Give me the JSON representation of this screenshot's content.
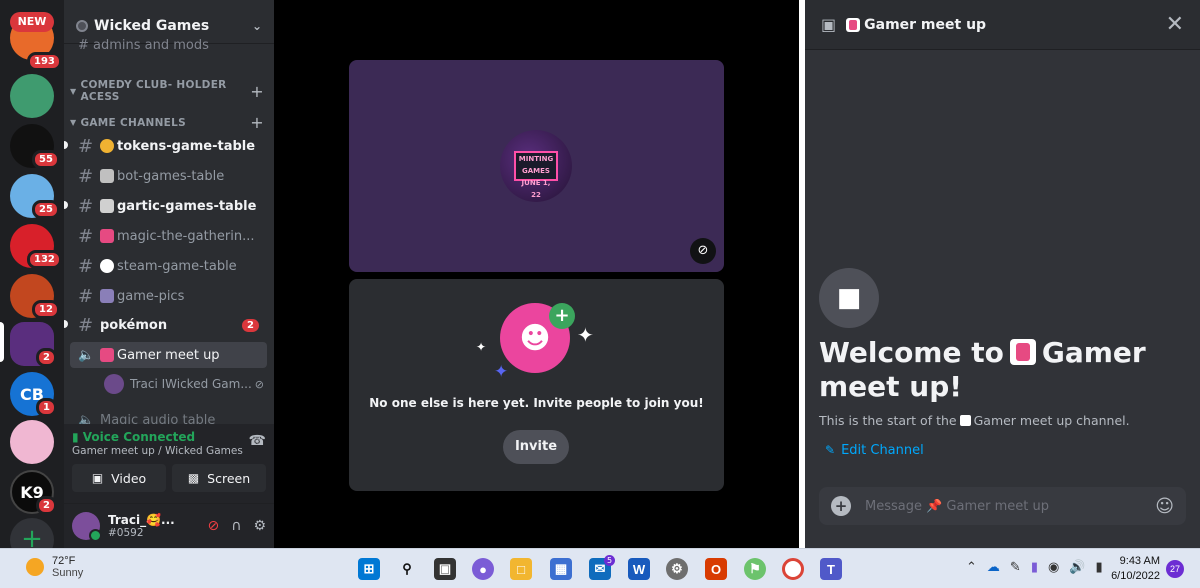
{
  "rail": {
    "new_badge": "NEW",
    "servers": [
      {
        "initials": "",
        "badge": "193",
        "color": "#e86a2a"
      },
      {
        "initials": "",
        "badge": "",
        "color": "#3f9b6f"
      },
      {
        "initials": "",
        "badge": "55",
        "color": "#111111"
      },
      {
        "initials": "",
        "badge": "25",
        "color": "#6ab0e6"
      },
      {
        "initials": "",
        "badge": "132",
        "color": "#d8202a"
      },
      {
        "initials": "",
        "badge": "12",
        "color": "#c2471f"
      },
      {
        "initials": "",
        "badge": "2",
        "color": "#5a2e7e"
      },
      {
        "initials": "CB",
        "badge": "1",
        "color": "#1673d4"
      },
      {
        "initials": "",
        "badge": "",
        "color": "#f0b7d2"
      },
      {
        "initials": "K9",
        "badge": "2",
        "color": "#0b0b0b"
      }
    ]
  },
  "sidebar": {
    "server_name": "Wicked Games",
    "cut_channel": "admins and mods",
    "categories": {
      "comedy": "COMEDY CLUB- HOLDER ACESS",
      "game": "GAME CHANNELS"
    },
    "channels": [
      {
        "name": "tokens-game-table",
        "emoji_color": "#f0b232"
      },
      {
        "name": "bot-games-table",
        "emoji_color": "#c0c0c0"
      },
      {
        "name": "gartic-games-table",
        "emoji_color": "#d0d0d0"
      },
      {
        "name": "magic-the-gatherin...",
        "emoji_color": "#e64a82"
      },
      {
        "name": "steam-game-table",
        "emoji_color": "#ffffff"
      },
      {
        "name": "game-pics",
        "emoji_color": "#8a7fb8"
      }
    ],
    "pokemon": {
      "name": "pokémon",
      "mentions": "2"
    },
    "voice_channel": "Gamer meet up",
    "voice_user": "Traci IWicked Gam...",
    "next_channel": "Magic audio table"
  },
  "voice_panel": {
    "status": "Voice Connected",
    "sub": "Gamer meet up / Wicked Games",
    "video_label": "Video",
    "screen_label": "Screen"
  },
  "user": {
    "name": "Traci_🥰...",
    "tag": "#0592"
  },
  "stage": {
    "sign_text": "MINTING GAMES JUNE 1, 22",
    "empty_message": "No one else is here yet. Invite people to join you!",
    "invite_label": "Invite"
  },
  "chat": {
    "title": "Gamer meet up",
    "welcome_prefix": "Welcome to",
    "welcome_name": "Gamer meet up!",
    "start_prefix": "This is the start of the",
    "start_suffix": "Gamer meet up channel.",
    "edit_label": "Edit Channel",
    "composer_placeholder": "Message 📌 Gamer meet up"
  },
  "taskbar": {
    "temp": "72°F",
    "weather": "Sunny",
    "mail_badge": "5",
    "time": "9:43 AM",
    "date": "6/10/2022",
    "notif_count": "27"
  }
}
